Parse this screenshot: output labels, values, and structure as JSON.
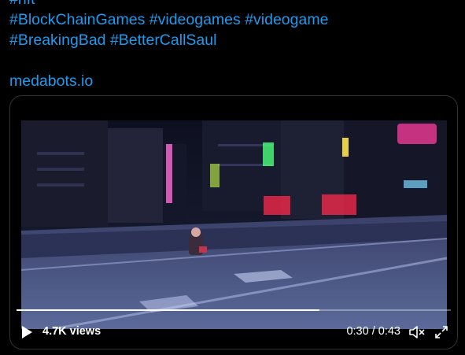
{
  "tweet": {
    "hashtag_line_0": "#nft",
    "hashtags_line_1": [
      "#BlockChainGames",
      "#videogames",
      "#videogame"
    ],
    "hashtags_line_2": [
      "#BreakingBad",
      "#BetterCallSaul"
    ],
    "link": "medabots.io"
  },
  "video": {
    "views_count": "4.7K",
    "views_suffix": " views",
    "current_time": "0:30",
    "separator": " / ",
    "duration": "0:43",
    "progress": 0.6977
  },
  "colors": {
    "link": "#1d9bf0",
    "background": "#000000",
    "card_border": "#2f3336"
  },
  "icons": {
    "play": "play-icon",
    "mute": "volume-muted-icon",
    "fullscreen": "fullscreen-icon"
  }
}
